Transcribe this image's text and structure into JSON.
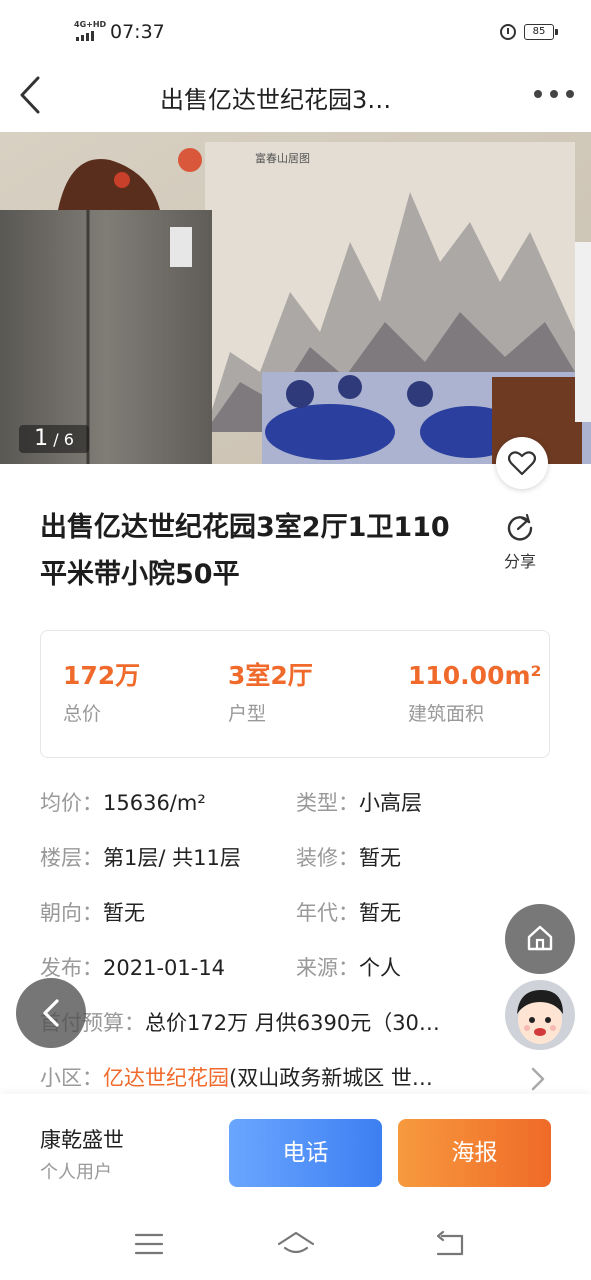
{
  "status_bar": {
    "network": "4G+HD",
    "time": "07:37",
    "battery": "85"
  },
  "nav": {
    "title": "出售亿达世纪花园3…"
  },
  "gallery": {
    "current": "1",
    "separator": "/",
    "total": "6"
  },
  "listing": {
    "title_line1": "出售亿达世纪花园3室2厅1卫110",
    "title_line2": "平米带小院50平",
    "share_label": "分享"
  },
  "summary": [
    {
      "value": "172万",
      "label": "总价"
    },
    {
      "value": "3室2厅",
      "label": "户型"
    },
    {
      "value": "110.00m²",
      "label": "建筑面积"
    }
  ],
  "details": {
    "unit_price": {
      "key": "均价：",
      "value": "15636/m²"
    },
    "type": {
      "key": "类型：",
      "value": "小高层"
    },
    "floor": {
      "key": "楼层：",
      "value": "第1层/ 共11层"
    },
    "decoration": {
      "key": "装修：",
      "value": "暂无"
    },
    "orientation": {
      "key": "朝向：",
      "value": "暂无"
    },
    "era": {
      "key": "年代：",
      "value": "暂无"
    },
    "published": {
      "key": "发布：",
      "value": "2021-01-14"
    },
    "source": {
      "key": "来源：",
      "value": "个人"
    },
    "budget": {
      "key": "首付预算：",
      "value": "总价172万 月供6390元（30…"
    },
    "community": {
      "key": "小区：",
      "link": "亿达世纪花园",
      "value": "(双山政务新城区 世…"
    }
  },
  "agent": {
    "name": "康乾盛世",
    "role": "个人用户"
  },
  "actions": {
    "call": "电话",
    "poster": "海报"
  },
  "colors": {
    "accent_orange": "#f06a2b",
    "call_blue": "#3d7ff2",
    "muted_gray": "#999999"
  }
}
